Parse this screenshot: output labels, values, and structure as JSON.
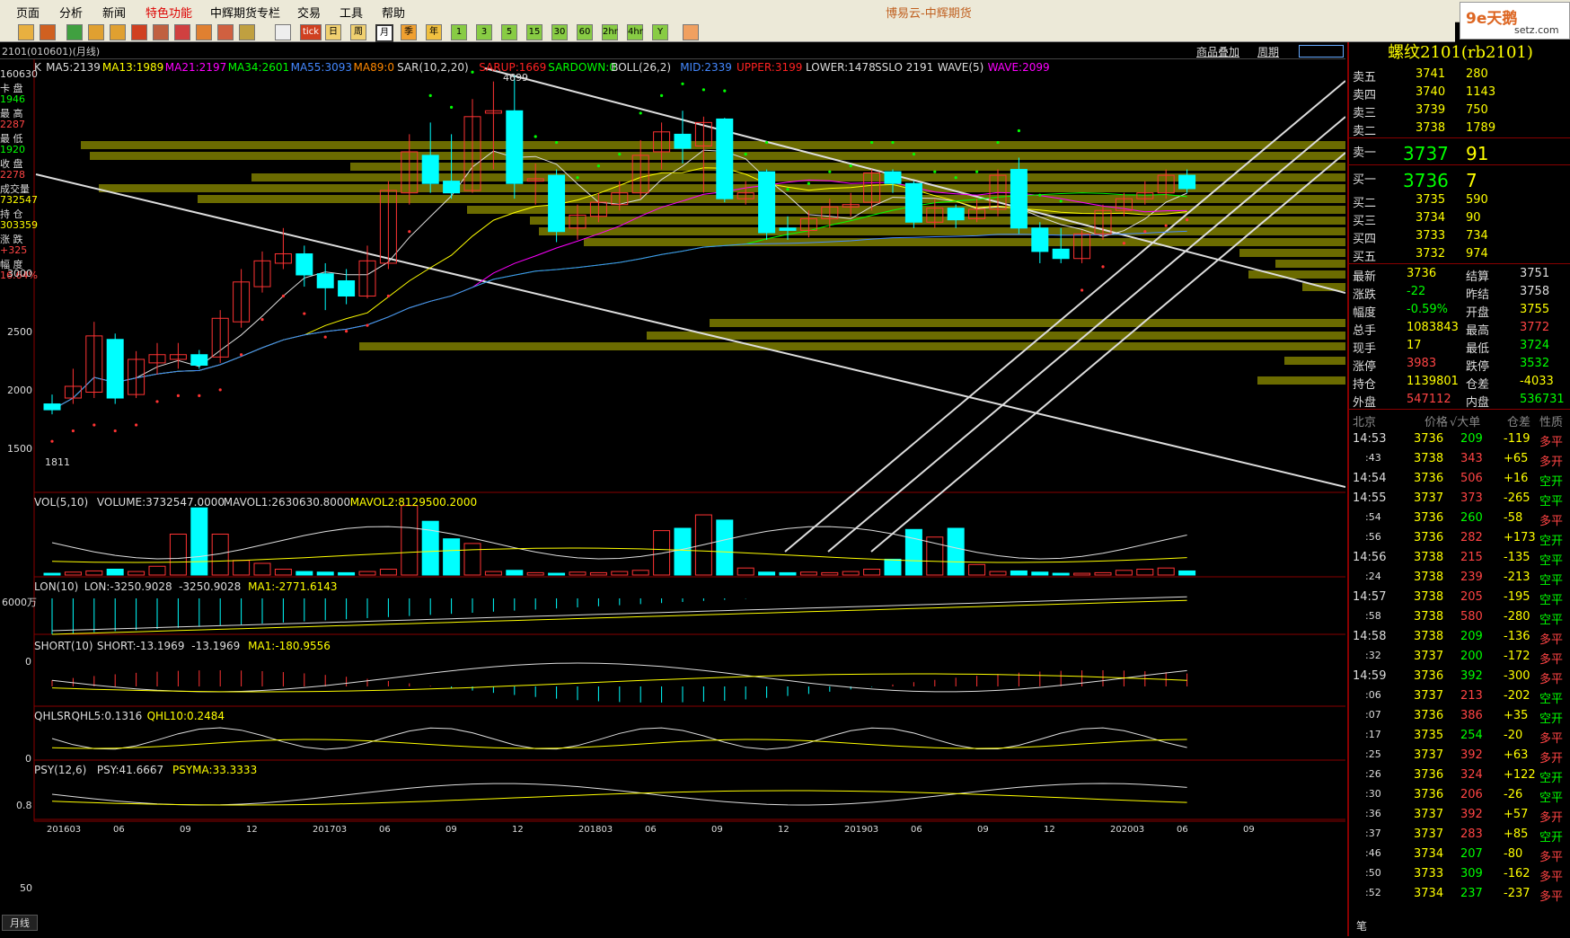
{
  "menu": [
    "页面",
    "分析",
    "新闻",
    "特色功能",
    "中辉期货专栏",
    "交易",
    "工具",
    "帮助"
  ],
  "app_title": "博易云-中辉期货",
  "brand": {
    "logo": "9e天鹅",
    "url": "setz.com"
  },
  "toolbar": {
    "period_labels": [
      "日",
      "周",
      "月",
      "季",
      "年",
      "1",
      "3",
      "5",
      "15",
      "30",
      "60",
      "2hr",
      "4hr",
      "Y"
    ],
    "tick_label": "tick"
  },
  "infobar": {
    "code": "2101(010601)(月线)",
    "overlay_label": "商品叠加",
    "cycle_label": "周期"
  },
  "indicators": {
    "kline": [
      {
        "t": "K",
        "c": "#ddd"
      },
      {
        "t": "MA5:2139",
        "c": "#ddd"
      },
      {
        "t": "MA13:1989",
        "c": "#ff0"
      },
      {
        "t": "MA21:2197",
        "c": "#f0f"
      },
      {
        "t": "MA34:2601",
        "c": "#0f0"
      },
      {
        "t": "MA55:3093",
        "c": "#48f"
      },
      {
        "t": "MA89:0",
        "c": "#f80"
      },
      {
        "t": "SAR(10,2,20)",
        "c": "#ddd"
      },
      {
        "t": "SARUP:1669",
        "c": "#f22"
      },
      {
        "t": "SARDOWN:0",
        "c": "#0f0"
      },
      {
        "t": "BOLL(26,2)",
        "c": "#ddd"
      },
      {
        "t": "MID:2339",
        "c": "#48f"
      },
      {
        "t": "UPPER:3199",
        "c": "#f22"
      },
      {
        "t": "LOWER:1478",
        "c": "#ddd"
      },
      {
        "t": "SSLO 2191",
        "c": "#ddd"
      },
      {
        "t": "WAVE(5)",
        "c": "#ddd"
      },
      {
        "t": "WAVE:2099",
        "c": "#f0f"
      }
    ],
    "vol": [
      {
        "t": "VOL(5,10)",
        "c": "#ddd"
      },
      {
        "t": "VOLUME:3732547.0000",
        "c": "#ddd"
      },
      {
        "t": "MAVOL1:2630630.8000",
        "c": "#ddd"
      },
      {
        "t": "MAVOL2:8129500.2000",
        "c": "#ff0"
      }
    ],
    "lon": [
      {
        "t": "LON(10)",
        "c": "#ddd"
      },
      {
        "t": "LON:-3250.9028",
        "c": "#ddd"
      },
      {
        "t": "-3250.9028",
        "c": "#ddd"
      },
      {
        "t": "MA1:-2771.6143",
        "c": "#ff0"
      }
    ],
    "short": [
      {
        "t": "SHORT(10)",
        "c": "#ddd"
      },
      {
        "t": "SHORT:-13.1969",
        "c": "#ddd"
      },
      {
        "t": "-13.1969",
        "c": "#ddd"
      },
      {
        "t": "MA1:-180.9556",
        "c": "#ff0"
      }
    ],
    "qhlsr": [
      {
        "t": "QHLSR",
        "c": "#ddd"
      },
      {
        "t": "QHL5:0.1316",
        "c": "#ddd"
      },
      {
        "t": "QHL10:0.2484",
        "c": "#ff0"
      }
    ],
    "psy": [
      {
        "t": "PSY(12,6)",
        "c": "#ddd"
      },
      {
        "t": "PSY:41.6667",
        "c": "#ddd"
      },
      {
        "t": "PSYMA:33.3333",
        "c": "#ff0"
      }
    ]
  },
  "left_panel": [
    {
      "t": "160630",
      "c": "#ddd"
    },
    {
      "t": "卡 盘",
      "c": "#ddd"
    },
    {
      "t": "1946",
      "c": "#0f0"
    },
    {
      "t": "最 高",
      "c": "#ddd"
    },
    {
      "t": "2287",
      "c": "#f44"
    },
    {
      "t": "最 低",
      "c": "#ddd"
    },
    {
      "t": "1920",
      "c": "#0f0"
    },
    {
      "t": "收 盘",
      "c": "#ddd"
    },
    {
      "t": "2278",
      "c": "#f44"
    },
    {
      "t": "成交量",
      "c": "#ddd"
    },
    {
      "t": "732547",
      "c": "#ff0"
    },
    {
      "t": "持 仓",
      "c": "#ddd"
    },
    {
      "t": "303359",
      "c": "#ff0"
    },
    {
      "t": "涨 跌",
      "c": "#ddd"
    },
    {
      "t": "+325",
      "c": "#f44"
    },
    {
      "t": "幅 度",
      "c": "#ddd"
    },
    {
      "t": "16.64%",
      "c": "#f44"
    }
  ],
  "chart_labels": {
    "high": "4699",
    "low": "1811",
    "vol_axis": "6000万",
    "lon_axis": "0",
    "short_axis": "0",
    "qhlsr_axis": "0.8",
    "psy_axis": "50",
    "period_btn": "月线"
  },
  "price_axis": [
    "3000",
    "2500",
    "2000",
    "1500"
  ],
  "time_axis": [
    "201603",
    "06",
    "09",
    "12",
    "201703",
    "06",
    "09",
    "12",
    "201803",
    "06",
    "09",
    "12",
    "201903",
    "06",
    "09",
    "12",
    "202003",
    "06",
    "09"
  ],
  "quote": {
    "title": "螺纹2101(rb2101)",
    "asks": [
      {
        "l": "卖五",
        "p": "3741",
        "v": "280"
      },
      {
        "l": "卖四",
        "p": "3740",
        "v": "1143"
      },
      {
        "l": "卖三",
        "p": "3739",
        "v": "750"
      },
      {
        "l": "卖二",
        "p": "3738",
        "v": "1789"
      }
    ],
    "ask1": {
      "l": "卖一",
      "p": "3737",
      "v": "91"
    },
    "bid1": {
      "l": "买一",
      "p": "3736",
      "v": "7"
    },
    "bids": [
      {
        "l": "买二",
        "p": "3735",
        "v": "590"
      },
      {
        "l": "买三",
        "p": "3734",
        "v": "90"
      },
      {
        "l": "买四",
        "p": "3733",
        "v": "734"
      },
      {
        "l": "买五",
        "p": "3732",
        "v": "974"
      }
    ],
    "stats": [
      {
        "a": "最新",
        "av": "3736",
        "ac": "#ff0",
        "b": "结算",
        "bv": "3751",
        "bc": "#ddd"
      },
      {
        "a": "涨跌",
        "av": "-22",
        "ac": "#0f0",
        "b": "昨结",
        "bv": "3758",
        "bc": "#ddd"
      },
      {
        "a": "幅度",
        "av": "-0.59%",
        "ac": "#0f0",
        "b": "开盘",
        "bv": "3755",
        "bc": "#ff0"
      },
      {
        "a": "总手",
        "av": "1083843",
        "ac": "#ff0",
        "b": "最高",
        "bv": "3772",
        "bc": "#f44"
      },
      {
        "a": "现手",
        "av": "17",
        "ac": "#ff0",
        "b": "最低",
        "bv": "3724",
        "bc": "#0f0"
      },
      {
        "a": "涨停",
        "av": "3983",
        "ac": "#f44",
        "b": "跌停",
        "bv": "3532",
        "bc": "#0f0"
      },
      {
        "a": "持仓",
        "av": "1139801",
        "ac": "#ff0",
        "b": "仓差",
        "bv": "-4033",
        "bc": "#ff0"
      },
      {
        "a": "外盘",
        "av": "547112",
        "ac": "#f44",
        "b": "内盘",
        "bv": "536731",
        "bc": "#0f0"
      }
    ],
    "tick_header": [
      "北京",
      "价格",
      "√大单",
      "仓差",
      "性质"
    ],
    "ticks": [
      {
        "t": "14:53",
        "p": "3736",
        "v": "209",
        "d": "-119",
        "n": "多平"
      },
      {
        "t": ":43",
        "p": "3738",
        "v": "343",
        "d": "+65",
        "n": "多开"
      },
      {
        "t": "14:54",
        "p": "3736",
        "v": "506",
        "d": "+16",
        "n": "空开"
      },
      {
        "t": "14:55",
        "p": "3737",
        "v": "373",
        "d": "-265",
        "n": "空平"
      },
      {
        "t": ":54",
        "p": "3736",
        "v": "260",
        "d": "-58",
        "n": "多平"
      },
      {
        "t": ":56",
        "p": "3736",
        "v": "282",
        "d": "+173",
        "n": "空开"
      },
      {
        "t": "14:56",
        "p": "3738",
        "v": "215",
        "d": "-135",
        "n": "空平"
      },
      {
        "t": ":24",
        "p": "3738",
        "v": "239",
        "d": "-213",
        "n": "空平"
      },
      {
        "t": "14:57",
        "p": "3738",
        "v": "205",
        "d": "-195",
        "n": "空平"
      },
      {
        "t": ":58",
        "p": "3738",
        "v": "580",
        "d": "-280",
        "n": "空平"
      },
      {
        "t": "14:58",
        "p": "3738",
        "v": "209",
        "d": "-136",
        "n": "多平"
      },
      {
        "t": ":32",
        "p": "3737",
        "v": "200",
        "d": "-172",
        "n": "多平"
      },
      {
        "t": "14:59",
        "p": "3736",
        "v": "392",
        "d": "-300",
        "n": "多平"
      },
      {
        "t": ":06",
        "p": "3737",
        "v": "213",
        "d": "-202",
        "n": "空平"
      },
      {
        "t": ":07",
        "p": "3736",
        "v": "386",
        "d": "+35",
        "n": "空开"
      },
      {
        "t": ":17",
        "p": "3735",
        "v": "254",
        "d": "-20",
        "n": "多平"
      },
      {
        "t": ":25",
        "p": "3737",
        "v": "392",
        "d": "+63",
        "n": "多开"
      },
      {
        "t": ":26",
        "p": "3736",
        "v": "324",
        "d": "+122",
        "n": "空开"
      },
      {
        "t": ":30",
        "p": "3736",
        "v": "206",
        "d": "-26",
        "n": "空平"
      },
      {
        "t": ":36",
        "p": "3737",
        "v": "392",
        "d": "+57",
        "n": "多开"
      },
      {
        "t": ":37",
        "p": "3737",
        "v": "283",
        "d": "+85",
        "n": "空开"
      },
      {
        "t": ":46",
        "p": "3734",
        "v": "207",
        "d": "-80",
        "n": "多平"
      },
      {
        "t": ":50",
        "p": "3733",
        "v": "309",
        "d": "-162",
        "n": "多平"
      },
      {
        "t": ":52",
        "p": "3734",
        "v": "237",
        "d": "-237",
        "n": "多平"
      }
    ],
    "footer_label": "笔"
  },
  "candles": [
    {
      "o": 1900,
      "c": 1850,
      "h": 1980,
      "l": 1811
    },
    {
      "o": 1950,
      "c": 2050,
      "h": 2200,
      "l": 1900
    },
    {
      "o": 2000,
      "c": 2480,
      "h": 2600,
      "l": 1950
    },
    {
      "o": 2450,
      "c": 1950,
      "h": 2500,
      "l": 1900
    },
    {
      "o": 1980,
      "c": 2280,
      "h": 2350,
      "l": 1950
    },
    {
      "o": 2250,
      "c": 2320,
      "h": 2420,
      "l": 2150
    },
    {
      "o": 2280,
      "c": 2320,
      "h": 2420,
      "l": 2200
    },
    {
      "o": 2320,
      "c": 2230,
      "h": 2360,
      "l": 2200
    },
    {
      "o": 2300,
      "c": 2630,
      "h": 2700,
      "l": 2250
    },
    {
      "o": 2600,
      "c": 2940,
      "h": 3050,
      "l": 2550
    },
    {
      "o": 2900,
      "c": 3120,
      "h": 3200,
      "l": 2850
    },
    {
      "o": 3100,
      "c": 3180,
      "h": 3400,
      "l": 3050
    },
    {
      "o": 3180,
      "c": 3000,
      "h": 3250,
      "l": 2900
    },
    {
      "o": 3010,
      "c": 2890,
      "h": 3100,
      "l": 2700
    },
    {
      "o": 2950,
      "c": 2820,
      "h": 3050,
      "l": 2750
    },
    {
      "o": 2820,
      "c": 3120,
      "h": 3250,
      "l": 2800
    },
    {
      "o": 3100,
      "c": 3720,
      "h": 3800,
      "l": 3050
    },
    {
      "o": 3700,
      "c": 4050,
      "h": 4200,
      "l": 3600
    },
    {
      "o": 4020,
      "c": 3780,
      "h": 4300,
      "l": 3700
    },
    {
      "o": 3800,
      "c": 3700,
      "h": 4200,
      "l": 3650
    },
    {
      "o": 3720,
      "c": 4350,
      "h": 4500,
      "l": 3700
    },
    {
      "o": 4380,
      "c": 4400,
      "h": 4650,
      "l": 3900
    },
    {
      "o": 4400,
      "c": 3780,
      "h": 4699,
      "l": 3650
    },
    {
      "o": 3800,
      "c": 3820,
      "h": 3950,
      "l": 3600
    },
    {
      "o": 3850,
      "c": 3370,
      "h": 3900,
      "l": 3280
    },
    {
      "o": 3400,
      "c": 3510,
      "h": 3600,
      "l": 3300
    },
    {
      "o": 3500,
      "c": 3620,
      "h": 3700,
      "l": 3450
    },
    {
      "o": 3600,
      "c": 3700,
      "h": 3800,
      "l": 3550
    },
    {
      "o": 3700,
      "c": 4020,
      "h": 4150,
      "l": 3650
    },
    {
      "o": 4050,
      "c": 4220,
      "h": 4300,
      "l": 3900
    },
    {
      "o": 4200,
      "c": 4080,
      "h": 4400,
      "l": 3950
    },
    {
      "o": 4100,
      "c": 4300,
      "h": 4350,
      "l": 3700
    },
    {
      "o": 4330,
      "c": 3650,
      "h": 4340,
      "l": 3620
    },
    {
      "o": 3650,
      "c": 3700,
      "h": 3800,
      "l": 3600
    },
    {
      "o": 3880,
      "c": 3360,
      "h": 3900,
      "l": 3300
    },
    {
      "o": 3400,
      "c": 3380,
      "h": 3500,
      "l": 3300
    },
    {
      "o": 3380,
      "c": 3480,
      "h": 3550,
      "l": 3320
    },
    {
      "o": 3480,
      "c": 3580,
      "h": 3650,
      "l": 3400
    },
    {
      "o": 3580,
      "c": 3600,
      "h": 3700,
      "l": 3500
    },
    {
      "o": 3620,
      "c": 3870,
      "h": 3900,
      "l": 3550
    },
    {
      "o": 3880,
      "c": 3780,
      "h": 3900,
      "l": 3700
    },
    {
      "o": 3780,
      "c": 3450,
      "h": 3800,
      "l": 3400
    },
    {
      "o": 3450,
      "c": 3570,
      "h": 3650,
      "l": 3400
    },
    {
      "o": 3570,
      "c": 3470,
      "h": 3600,
      "l": 3400
    },
    {
      "o": 3480,
      "c": 3560,
      "h": 3650,
      "l": 3450
    },
    {
      "o": 3560,
      "c": 3850,
      "h": 3900,
      "l": 3500
    },
    {
      "o": 3900,
      "c": 3400,
      "h": 4000,
      "l": 3350
    },
    {
      "o": 3400,
      "c": 3200,
      "h": 3450,
      "l": 3100
    },
    {
      "o": 3220,
      "c": 3140,
      "h": 3400,
      "l": 3100
    },
    {
      "o": 3140,
      "c": 3350,
      "h": 3380,
      "l": 3100
    },
    {
      "o": 3350,
      "c": 3550,
      "h": 3600,
      "l": 3300
    },
    {
      "o": 3550,
      "c": 3650,
      "h": 3700,
      "l": 3500
    },
    {
      "o": 3650,
      "c": 3700,
      "h": 3800,
      "l": 3600
    },
    {
      "o": 3700,
      "c": 3850,
      "h": 3900,
      "l": 3650
    },
    {
      "o": 3850,
      "c": 3736,
      "h": 3900,
      "l": 3700
    }
  ],
  "volumes": [
    0.3,
    0.5,
    0.7,
    1.0,
    0.6,
    1.5,
    7.0,
    11.5,
    7.0,
    2.5,
    2.0,
    1.0,
    0.6,
    0.5,
    0.4,
    0.6,
    1.0,
    11.9,
    9.2,
    6.2,
    5.4,
    0.6,
    0.8,
    0.4,
    0.3,
    0.5,
    0.4,
    0.6,
    0.8,
    7.6,
    8.0,
    10.3,
    9.4,
    1.2,
    0.5,
    0.4,
    0.5,
    0.4,
    0.6,
    1.0,
    2.7,
    7.8,
    6.5,
    8.0,
    1.8,
    0.6,
    0.7,
    0.5,
    0.3,
    0.3,
    0.4,
    0.8,
    1.0,
    1.2,
    0.7
  ]
}
